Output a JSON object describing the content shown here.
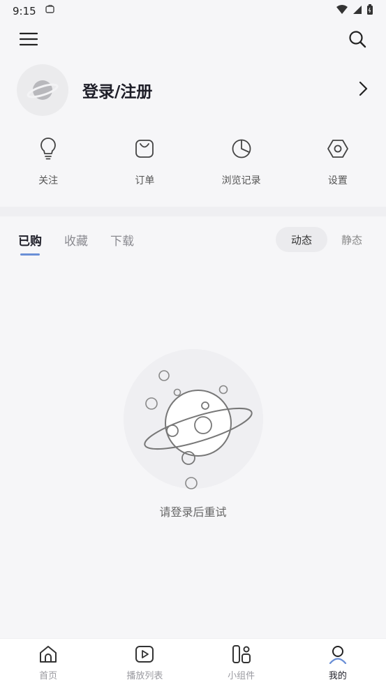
{
  "status": {
    "time": "9:15"
  },
  "profile": {
    "title": "登录/注册"
  },
  "quick_actions": [
    {
      "label": "关注",
      "icon": "bulb-icon"
    },
    {
      "label": "订单",
      "icon": "bag-icon"
    },
    {
      "label": "浏览记录",
      "icon": "pie-icon"
    },
    {
      "label": "设置",
      "icon": "hex-settings-icon"
    }
  ],
  "tabs": [
    {
      "label": "已购",
      "active": true
    },
    {
      "label": "收藏",
      "active": false
    },
    {
      "label": "下载",
      "active": false
    }
  ],
  "toggle": {
    "dynamic": "动态",
    "static": "静态"
  },
  "empty_state": {
    "message": "请登录后重试"
  },
  "bottom_nav": [
    {
      "label": "首页",
      "icon": "home-icon",
      "active": false
    },
    {
      "label": "播放列表",
      "icon": "play-list-icon",
      "active": false
    },
    {
      "label": "小组件",
      "icon": "widget-icon",
      "active": false
    },
    {
      "label": "我的",
      "icon": "profile-icon",
      "active": true
    }
  ],
  "colors": {
    "accent": "#6a8fd6",
    "background": "#f6f6f8"
  }
}
